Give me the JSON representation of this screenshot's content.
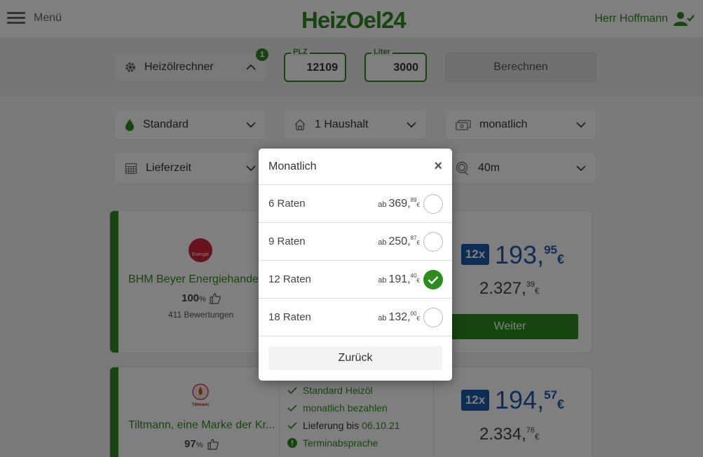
{
  "header": {
    "menu_label": "Menü",
    "logo": "HeizOel24",
    "user_name": "Herr Hoffmann"
  },
  "calculator": {
    "toggle_label": "Heizölrechner",
    "badge_count": "1",
    "plz_label": "PLZ",
    "plz_value": "12109",
    "liter_label": "Liter",
    "liter_value": "3000",
    "calculate_label": "Berechnen"
  },
  "filters": {
    "quality": "Standard",
    "household": "1 Haushalt",
    "payment": "monatlich",
    "delivery": "Lieferzeit",
    "hose": "40m"
  },
  "dealers": [
    {
      "name": "BHM Beyer Energiehandel ...",
      "rating": "100",
      "rating_unit": "%",
      "reviews": "411 Bewertungen",
      "rate_count": "12x",
      "rate_int": "193,",
      "rate_dec": "95",
      "currency": "€",
      "total_int": "2.327,",
      "total_dec": "39",
      "button": "Weiter"
    },
    {
      "name": "Tiltmann, eine Marke der Kr...",
      "rating": "97",
      "rating_unit": "%",
      "rate_count": "12x",
      "rate_int": "194,",
      "rate_dec": "57",
      "currency": "€",
      "total_int": "2.334,",
      "total_dec": "76",
      "features": [
        "Standard Heizöl",
        "monatlich bezahlen",
        "Lieferung bis",
        "Terminabsprache"
      ],
      "delivery_date": "06.10.21"
    }
  ],
  "modal": {
    "title": "Monatlich",
    "close": "×",
    "ab_label": "ab",
    "options": [
      {
        "label": "6 Raten",
        "int": "369,",
        "dec": "89",
        "cur": "€",
        "selected": false
      },
      {
        "label": "9 Raten",
        "int": "250,",
        "dec": "87",
        "cur": "€",
        "selected": false
      },
      {
        "label": "12 Raten",
        "int": "191,",
        "dec": "40",
        "cur": "€",
        "selected": true
      },
      {
        "label": "18 Raten",
        "int": "132,",
        "dec": "00",
        "cur": "€",
        "selected": false
      }
    ],
    "back_label": "Zurück"
  },
  "colors": {
    "brand_green": "#2e8b1e",
    "price_blue": "#1d5aa8"
  },
  "logo_marks": {
    "dealer1": "Energie",
    "dealer2": "Tiltmann"
  }
}
